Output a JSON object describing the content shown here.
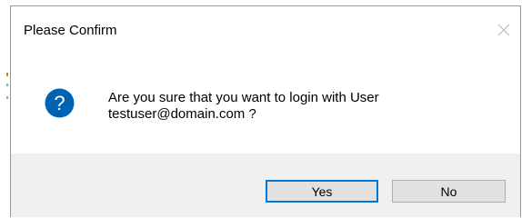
{
  "dialog": {
    "title": "Please Confirm",
    "message_line1": "Are you sure that you want to login with User",
    "message_line2": "testuser@domain.com ?",
    "icon": "question-icon",
    "close_icon": "close-icon"
  },
  "buttons": {
    "yes_label": "Yes",
    "no_label": "No"
  },
  "colors": {
    "icon_blue": "#0063b1",
    "focus_border": "#0078d7",
    "footer_bg": "#f0f0f0"
  }
}
